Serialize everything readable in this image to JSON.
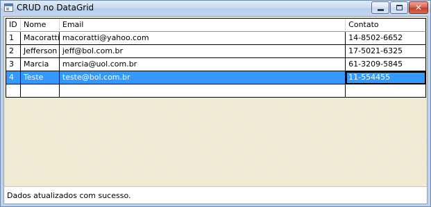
{
  "window": {
    "title": "CRUD no DataGrid",
    "close_glyph": "✕"
  },
  "grid": {
    "columns": [
      "ID",
      "Nome",
      "Email",
      "Contato"
    ],
    "rows": [
      [
        "1",
        "Macoratti",
        "macoratti@yahoo.com",
        "14-8502-6652"
      ],
      [
        "2",
        "Jefferson",
        "jeff@bol.com.br",
        "17-5021-6325"
      ],
      [
        "3",
        "Marcia",
        "marcia@uol.com.br",
        "61-3209-5845"
      ],
      [
        "4",
        "Teste",
        "teste@bol.com.br",
        "11-554455"
      ],
      [
        "",
        "",
        "",
        ""
      ]
    ],
    "selected_row_index": 3,
    "current_cell": "Contato"
  },
  "status": {
    "text": "Dados atualizados com sucesso."
  },
  "colors": {
    "selection": "#3399ff",
    "grid_background": "#efe8cf",
    "close_button": "#c3402a"
  },
  "icons": {
    "app": "app-window-icon",
    "minimize": "minimize-icon",
    "maximize": "maximize-icon",
    "close": "close-icon"
  }
}
